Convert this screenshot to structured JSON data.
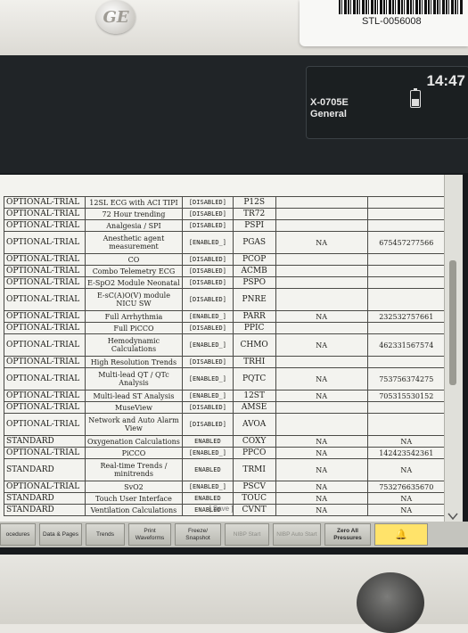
{
  "device": {
    "brand_logo": "GE",
    "asset_tag": "STL-0056008"
  },
  "status": {
    "monitor_name_line1": "X-0705E",
    "monitor_name_line2": "General",
    "time": "14:47"
  },
  "table": {
    "rows": [
      [
        "OPTIONAL-TRIAL",
        "12SL ECG with ACI TIPI",
        "[DISABLED]",
        "P12S",
        "",
        ""
      ],
      [
        "OPTIONAL-TRIAL",
        "72 Hour trending",
        "[DISABLED]",
        "TR72",
        "",
        ""
      ],
      [
        "OPTIONAL-TRIAL",
        "Analgesia / SPI",
        "[DISABLED]",
        "PSPI",
        "",
        ""
      ],
      [
        "OPTIONAL-TRIAL",
        "Anesthetic agent measurement",
        "[ENABLED_]",
        "PGAS",
        "NA",
        "675457277566"
      ],
      [
        "OPTIONAL-TRIAL",
        "CO",
        "[DISABLED]",
        "PCOP",
        "",
        ""
      ],
      [
        "OPTIONAL-TRIAL",
        "Combo Telemetry ECG",
        "[DISABLED]",
        "ACMB",
        "",
        ""
      ],
      [
        "OPTIONAL-TRIAL",
        "E-SpO2 Module Neonatal",
        "[DISABLED]",
        "PSPO",
        "",
        ""
      ],
      [
        "OPTIONAL-TRIAL",
        "E-sC(A)O(V) module NICU SW",
        "[DISABLED]",
        "PNRE",
        "",
        ""
      ],
      [
        "OPTIONAL-TRIAL",
        "Full Arrhythmia",
        "[ENABLED_]",
        "PARR",
        "NA",
        "232532757661"
      ],
      [
        "OPTIONAL-TRIAL",
        "Full PiCCO",
        "[DISABLED]",
        "PPIC",
        "",
        ""
      ],
      [
        "OPTIONAL-TRIAL",
        "Hemodynamic Calculations",
        "[ENABLED_]",
        "CHMO",
        "NA",
        "462331567574"
      ],
      [
        "OPTIONAL-TRIAL",
        "High Resolution Trends",
        "[DISABLED]",
        "TRHI",
        "",
        ""
      ],
      [
        "OPTIONAL-TRIAL",
        "Multi-lead QT / QTc Analysis",
        "[ENABLED_]",
        "PQTC",
        "NA",
        "753756374275"
      ],
      [
        "OPTIONAL-TRIAL",
        "Multi-lead ST Analysis",
        "[ENABLED_]",
        "12ST",
        "NA",
        "705315530152"
      ],
      [
        "OPTIONAL-TRIAL",
        "MuseView",
        "[DISABLED]",
        "AMSE",
        "",
        ""
      ],
      [
        "OPTIONAL-TRIAL",
        "Network and Auto Alarm View",
        "[DISABLED]",
        "AVOA",
        "",
        ""
      ],
      [
        "STANDARD",
        "Oxygenation Calculations",
        "ENABLED",
        "COXY",
        "NA",
        "NA"
      ],
      [
        "OPTIONAL-TRIAL",
        "PiCCO",
        "[ENABLED_]",
        "PPCO",
        "NA",
        "142423542361"
      ],
      [
        "STANDARD",
        "Real-time Trends / minitrends",
        "ENABLED",
        "TRMI",
        "NA",
        "NA"
      ],
      [
        "OPTIONAL-TRIAL",
        "SvO2",
        "[ENABLED_]",
        "PSCV",
        "NA",
        "753276635670"
      ],
      [
        "STANDARD",
        "Touch User Interface",
        "ENABLED",
        "TOUC",
        "NA",
        "NA"
      ],
      [
        "STANDARD",
        "Ventilation Calculations",
        "ENABLED",
        "CVNT",
        "NA",
        "NA"
      ]
    ],
    "tall_rows": [
      3,
      7,
      10,
      12,
      15,
      18
    ]
  },
  "save_label": "[ Save ]",
  "softkeys": [
    {
      "label": "ocedures",
      "state": "normal"
    },
    {
      "label": "Data & Pages",
      "state": "normal"
    },
    {
      "label": "Trends",
      "state": "normal"
    },
    {
      "label": "Print Waveforms",
      "state": "normal"
    },
    {
      "label": "Freeze/ Snapshot",
      "state": "normal"
    },
    {
      "label": "NIBP Start",
      "state": "dim"
    },
    {
      "label": "NIBP Auto Start",
      "state": "dim"
    },
    {
      "label": "Zero All Pressures",
      "state": "normal"
    },
    {
      "label": "alarm-bell-icon",
      "state": "alarm"
    }
  ],
  "colors": {
    "screen_bg": "#171a1d",
    "panel_bg": "#f3f3ef",
    "alarm_key": "#ffe36a"
  }
}
